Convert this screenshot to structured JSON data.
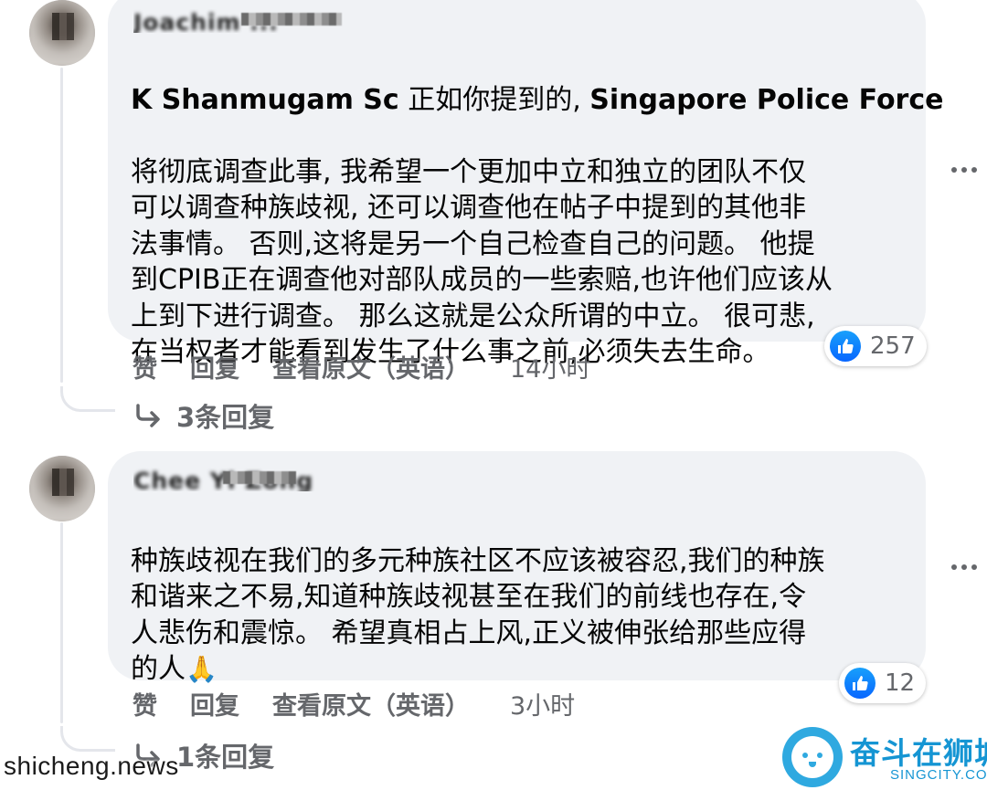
{
  "comments": [
    {
      "author_name": "Joachim ...",
      "text_bold_prefix": "K Shanmugam Sc",
      "text_line1_rest": " 正如你提到的, ",
      "text_bold_suffix": "Singapore Police Force",
      "text_body": "将彻底调查此事, 我希望一个更加中立和独立的团队不仅\n可以调查种族歧视, 还可以调查他在帖子中提到的其他非\n法事情。 否则,这将是另一个自己检查自己的问题。 他提\n到CPIB正在调查他对部队成员的一些索赔,也许他们应该从\n上到下进行调查。 那么这就是公众所谓的中立。 很可悲,\n在当权者才能看到发生了什么事之前,必须失去生命。",
      "like_label": "赞",
      "reply_label": "回复",
      "translate_label": "查看原文（英语）",
      "time": "14小时",
      "reaction_count": "257",
      "replies_label": "3条回复"
    },
    {
      "author_name": "Chee Yi Zong",
      "text_body": "种族歧视在我们的多元种族社区不应该被容忍,我们的种族\n和谐来之不易,知道种族歧视甚至在我们的前线也存在,令\n人悲伤和震惊。 希望真相占上风,正义被伸张给那些应得\n的人",
      "emoji": "🙏",
      "like_label": "赞",
      "reply_label": "回复",
      "translate_label": "查看原文（英语）",
      "time": "3小时",
      "reaction_count": "12",
      "replies_label": "1条回复"
    }
  ],
  "watermark": {
    "left": "shicheng.news",
    "brand_title": "奋斗在狮城",
    "brand_sub": "SINGCITY.COM"
  },
  "colors": {
    "bubble": "#f0f2f5",
    "action_text": "#65676b",
    "like_blue": "#0866ff",
    "brand_blue": "#1595d3"
  },
  "icons": [
    "like-icon",
    "reply-arrow-icon",
    "more-options-icon",
    "folded-hands-emoji",
    "lion-logo-icon"
  ]
}
